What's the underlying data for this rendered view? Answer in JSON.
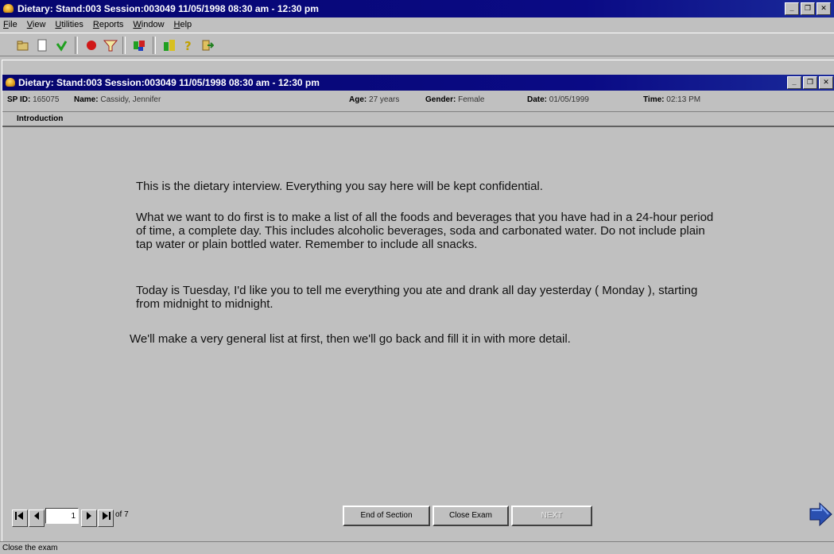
{
  "app": {
    "title": "Dietary: Stand:003 Session:003049 11/05/1998 08:30 am - 12:30 pm",
    "menu": [
      "File",
      "View",
      "Utilities",
      "Reports",
      "Window",
      "Help"
    ]
  },
  "toolbar": {
    "icons": [
      "open-icon",
      "new-icon",
      "save-icon",
      "record-icon",
      "filter-icon",
      "tools-icon",
      "chart-icon",
      "help-icon",
      "exit-icon"
    ]
  },
  "child": {
    "title": "Dietary: Stand:003 Session:003049 11/05/1998 08:30 am - 12:30 pm"
  },
  "info": {
    "sp_id_label": "SP ID:",
    "sp_id": "165075",
    "name_label": "Name:",
    "name": "Cassidy, Jennifer",
    "age_label": "Age:",
    "age": "27 years",
    "gender_label": "Gender:",
    "gender": "Female",
    "date_label": "Date:",
    "date": "01/05/1999",
    "time_label": "Time:",
    "time": "02:13 PM"
  },
  "section": {
    "title": "Introduction"
  },
  "content": {
    "p1": "This is the dietary interview. Everything you say here will be kept confidential.",
    "p2": "What we want to do first is to make a list of all the foods and beverages that you have had in a 24-hour period of time, a complete day. This includes alcoholic beverages, soda and carbonated water. Do not include plain tap water or plain bottled water. Remember to include all snacks.",
    "p3": "Today is Tuesday, I'd like you to tell me everything you ate and drank all day yesterday ( Monday ), starting from midnight to midnight.",
    "p4": "We'll make a very general list at first, then we'll go back and fill it in with more detail."
  },
  "navigation": {
    "page_value": "1",
    "of_label": "of 7",
    "end_section": "End of Section",
    "close_exam": "Close Exam",
    "next": "NEXT"
  },
  "status": {
    "text": "Close the exam"
  },
  "colors": {
    "titlebar": "#0a0a85",
    "background": "#c0c0c0"
  }
}
